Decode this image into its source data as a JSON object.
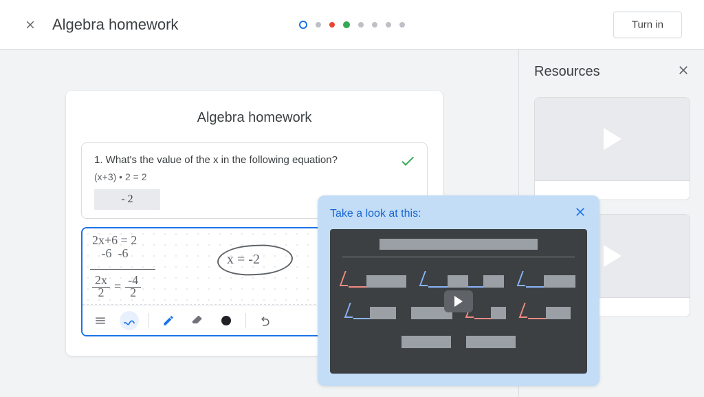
{
  "appbar": {
    "title": "Algebra homework",
    "turn_in_label": "Turn in",
    "stepper": {
      "total": 8,
      "current_index": 0,
      "markers": {
        "red_index": 2,
        "green_index": 3
      }
    }
  },
  "worksheet": {
    "heading": "Algebra homework",
    "question": {
      "number": 1,
      "prompt": "1. What's the value of the x in the following equation?",
      "equation": "(x+3) • 2 = 2",
      "entered_answer": "- 2",
      "status": "correct"
    },
    "scratch": {
      "lines": [
        "2x+6 = 2",
        "   -6  -6"
      ],
      "fraction_left": {
        "num": "2x",
        "den": "2"
      },
      "fraction_right": {
        "num": "-4",
        "den": "2"
      },
      "circled_result": "x = -2",
      "toolbar": {
        "items": [
          "list",
          "draw",
          "pen",
          "eraser",
          "color",
          "undo"
        ],
        "active": "draw",
        "current_color": "#202124"
      }
    }
  },
  "resources": {
    "heading": "Resources",
    "cards": [
      {
        "type": "video"
      },
      {
        "type": "video"
      }
    ]
  },
  "hint": {
    "title": "Take a look at this:",
    "media": "video-placeholder"
  }
}
